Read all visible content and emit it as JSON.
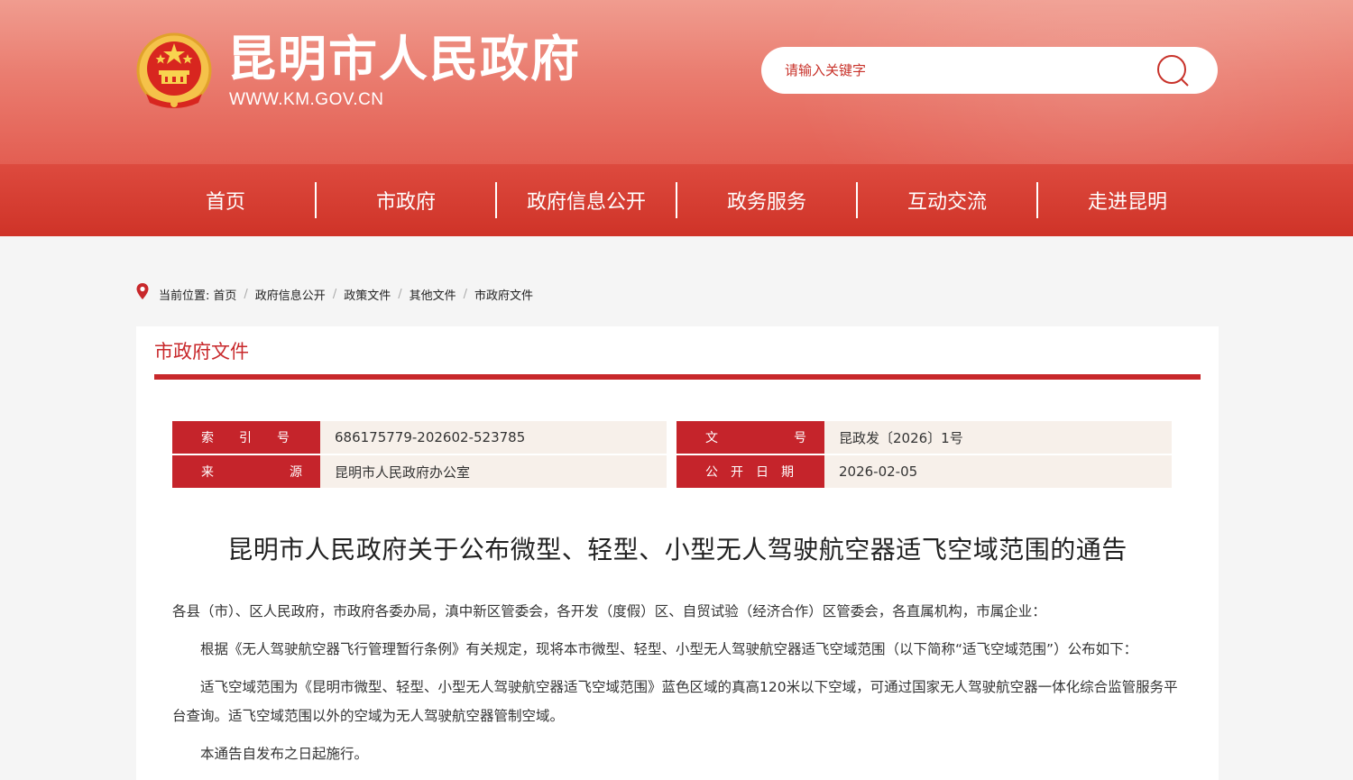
{
  "header": {
    "site_title": "昆明市人民政府",
    "site_url": "WWW.KM.GOV.CN",
    "search_placeholder": "请输入关键字"
  },
  "nav": {
    "items": [
      {
        "label": "首页"
      },
      {
        "label": "市政府"
      },
      {
        "label": "政府信息公开"
      },
      {
        "label": "政务服务"
      },
      {
        "label": "互动交流"
      },
      {
        "label": "走进昆明"
      }
    ]
  },
  "breadcrumb": {
    "prefix": "当前位置:",
    "items": [
      "首页",
      "政府信息公开",
      "政策文件",
      "其他文件",
      "市政府文件"
    ],
    "separator": "/"
  },
  "panel": {
    "title": "市政府文件"
  },
  "meta": {
    "index_label": "索　　引　　号",
    "index_value": "686175779-202602-523785",
    "docno_label": "文　　　　　　号",
    "docno_value": "昆政发〔2026〕1号",
    "source_label": "来　　　　　　源",
    "source_value": "昆明市人民政府办公室",
    "date_label": "公　开　日　期",
    "date_value": "2026-02-05"
  },
  "document": {
    "title": "昆明市人民政府关于公布微型、轻型、小型无人驾驶航空器适飞空域范围的通告",
    "addressee": "各县（市）、区人民政府，市政府各委办局，滇中新区管委会，各开发（度假）区、自贸试验（经济合作）区管委会，各直属机构，市属企业：",
    "paragraphs": [
      "根据《无人驾驶航空器飞行管理暂行条例》有关规定，现将本市微型、轻型、小型无人驾驶航空器适飞空域范围（以下简称“适飞空域范围”）公布如下：",
      "适飞空域范围为《昆明市微型、轻型、小型无人驾驶航空器适飞空域范围》蓝色区域的真高120米以下空域，可通过国家无人驾驶航空器一体化综合监管服务平台查询。适飞空域范围以外的空域为无人驾驶航空器管制空域。",
      "本通告自发布之日起施行。"
    ]
  },
  "colors": {
    "brand_red": "#c8282b",
    "nav_red": "#d63d31",
    "meta_value_bg": "#f7f0ea"
  }
}
